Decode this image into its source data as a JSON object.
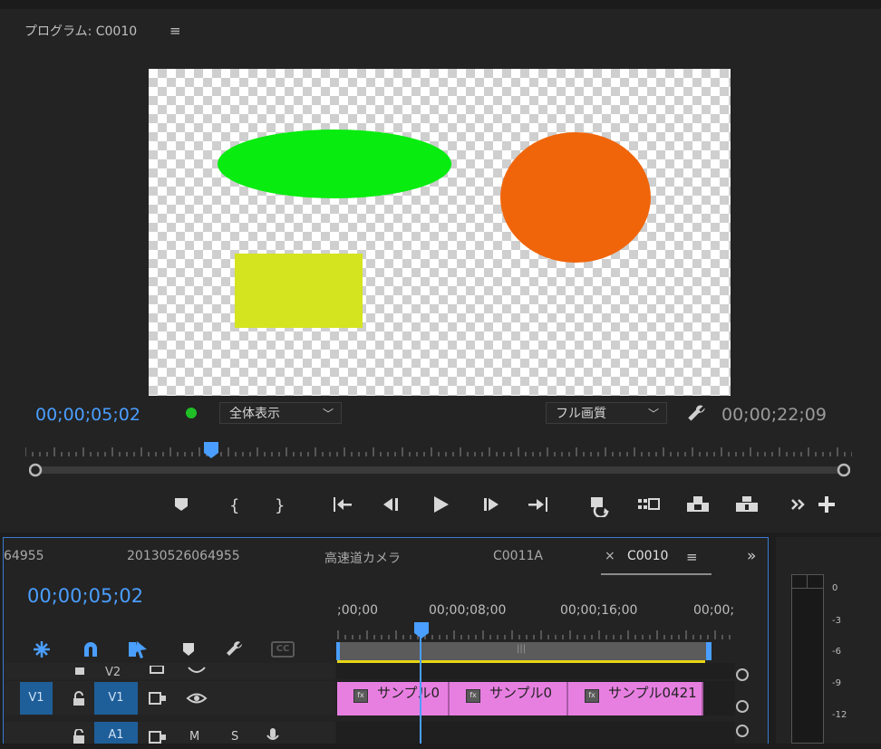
{
  "program": {
    "title": "プログラム: C0010",
    "menu_icon": "hamburger-menu-icon",
    "current_timecode": "00;00;05;02",
    "duration_timecode": "00;00;22;09",
    "zoom_select": "全体表示",
    "quality_select": "フル画質",
    "status_color": "#1fbf25",
    "shapes": [
      {
        "name": "green-ellipse",
        "color": "#08ec10"
      },
      {
        "name": "orange-circle",
        "color": "#f0650a"
      },
      {
        "name": "yellow-rectangle",
        "color": "#d4e41f"
      }
    ],
    "transport_buttons": [
      {
        "name": "add-marker-button",
        "icon": "marker-icon"
      },
      {
        "name": "mark-in-button",
        "icon": "mark-in-icon"
      },
      {
        "name": "mark-out-button",
        "icon": "mark-out-icon"
      },
      {
        "name": "go-to-in-button",
        "icon": "go-to-in-icon"
      },
      {
        "name": "step-back-button",
        "icon": "step-back-icon"
      },
      {
        "name": "play-button",
        "icon": "play-icon"
      },
      {
        "name": "step-forward-button",
        "icon": "step-forward-icon"
      },
      {
        "name": "go-to-out-button",
        "icon": "go-to-out-icon"
      },
      {
        "name": "loop-button",
        "icon": "loop-icon"
      },
      {
        "name": "safe-margins-button",
        "icon": "safe-margins-icon"
      },
      {
        "name": "lift-button",
        "icon": "lift-icon"
      },
      {
        "name": "extract-button",
        "icon": "extract-icon"
      },
      {
        "name": "more-controls-button",
        "icon": "double-chevron-right-icon"
      },
      {
        "name": "button-editor-button",
        "icon": "plus-icon"
      }
    ]
  },
  "timeline": {
    "tabs": [
      "64955",
      "20130526064955",
      "高速道カメラ",
      "C0011A",
      "C0010"
    ],
    "close_glyph": "×",
    "active_tab": "C0010",
    "timecode": "00;00;05;02",
    "ruler_labels": [
      ";00;00",
      "00;00;08;00",
      "00;00;16;00",
      "00;00;"
    ],
    "work_area_glyph": "|||",
    "tools": [
      "snap-icon",
      "magnet-icon",
      "linked-selection-icon",
      "add-marker-icon",
      "settings-wrench-icon",
      "captions-icon"
    ],
    "captions_label": "CC",
    "tracks": {
      "v2": {
        "label": "V2"
      },
      "v1": {
        "source": "V1",
        "label": "V1"
      },
      "a1": {
        "label": "A1",
        "mute": "M",
        "solo": "S"
      }
    },
    "clips": [
      "サンプル0",
      "サンプル0",
      "サンプル0421"
    ],
    "fx_badge": "fx",
    "clip_color": "#e77fe1"
  },
  "audio_meter": {
    "scale": [
      "0",
      "-3",
      "-6",
      "-9",
      "-12"
    ]
  }
}
